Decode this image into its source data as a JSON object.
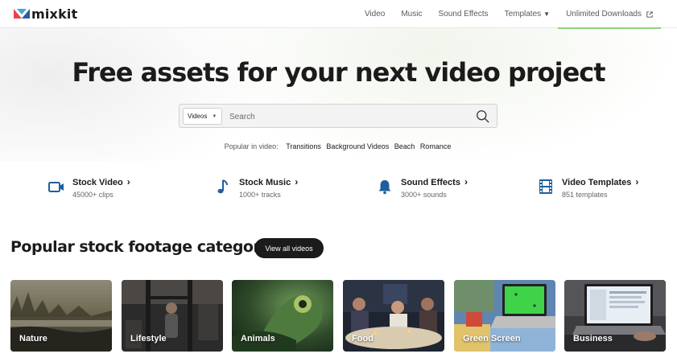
{
  "brand": {
    "name": "mixkit",
    "colors": {
      "accent_green": "#8bd57c",
      "logo_red": "#e8434f",
      "logo_blue": "#2c5aa0",
      "icon_blue": "#1f5f9e"
    }
  },
  "nav": {
    "items": [
      {
        "label": "Video"
      },
      {
        "label": "Music"
      },
      {
        "label": "Sound Effects"
      },
      {
        "label": "Templates",
        "has_dropdown": true
      },
      {
        "label": "Unlimited Downloads",
        "icon": "external-link-icon",
        "active": true
      }
    ]
  },
  "hero": {
    "title": "Free assets for your next video project",
    "search": {
      "select_value": "Videos",
      "placeholder": "Search",
      "icon": "search-icon"
    },
    "popular": {
      "label": "Popular in video:",
      "links": [
        "Transitions",
        "Background Videos",
        "Beach",
        "Romance"
      ]
    }
  },
  "assets": [
    {
      "title": "Stock Video",
      "subtitle": "45000+ clips",
      "icon": "video-camera-icon"
    },
    {
      "title": "Stock Music",
      "subtitle": "1000+ tracks",
      "icon": "music-note-icon"
    },
    {
      "title": "Sound Effects",
      "subtitle": "3000+ sounds",
      "icon": "bell-icon"
    },
    {
      "title": "Video Templates",
      "subtitle": "851 templates",
      "icon": "film-strip-icon"
    }
  ],
  "categories": {
    "title": "Popular stock footage categories",
    "view_all_label": "View all videos",
    "items": [
      {
        "label": "Nature"
      },
      {
        "label": "Lifestyle"
      },
      {
        "label": "Animals"
      },
      {
        "label": "Food"
      },
      {
        "label": "Green Screen"
      },
      {
        "label": "Business"
      }
    ]
  }
}
